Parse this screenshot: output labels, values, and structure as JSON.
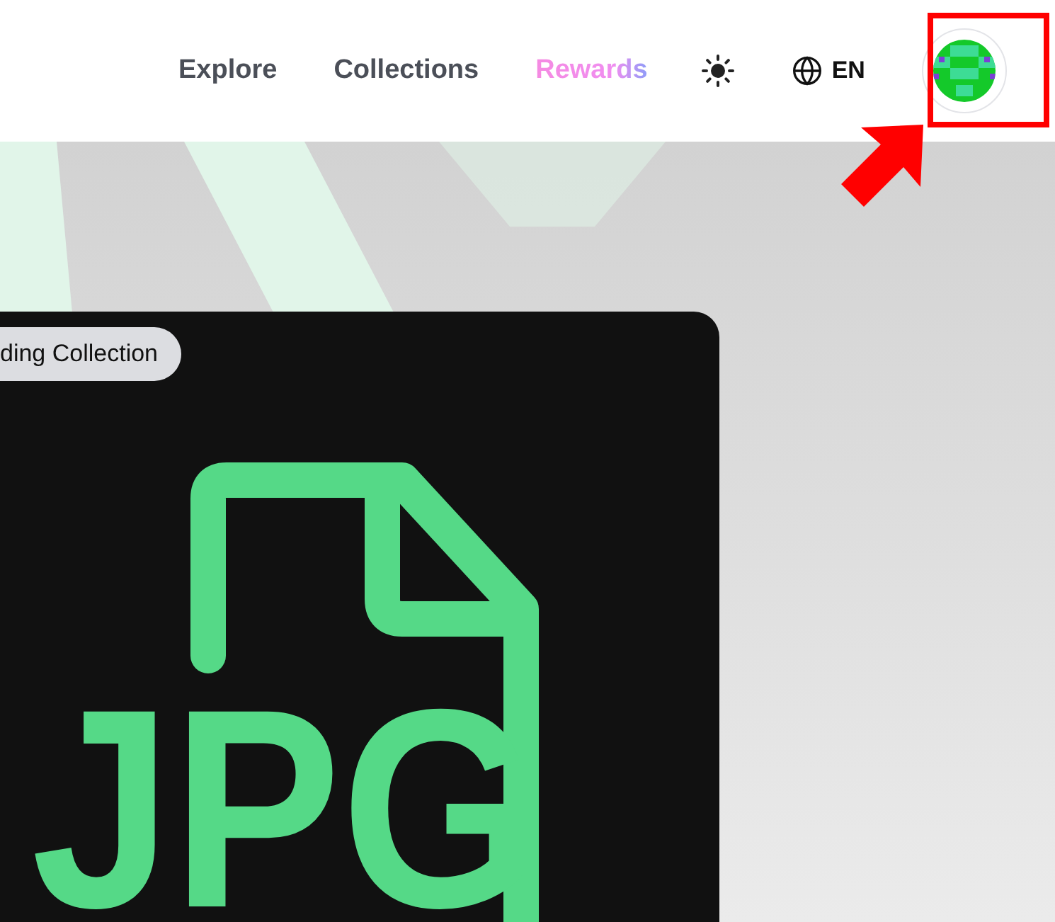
{
  "header": {
    "links": [
      {
        "label": "Explore",
        "kind": "plain"
      },
      {
        "label": "Collections",
        "kind": "plain"
      },
      {
        "label": "Rewards",
        "kind": "gradient"
      }
    ],
    "language": "EN",
    "avatar": {
      "highlighted": true
    }
  },
  "hero": {
    "badge": "ding Collection",
    "file_icon_label": "JPG"
  }
}
